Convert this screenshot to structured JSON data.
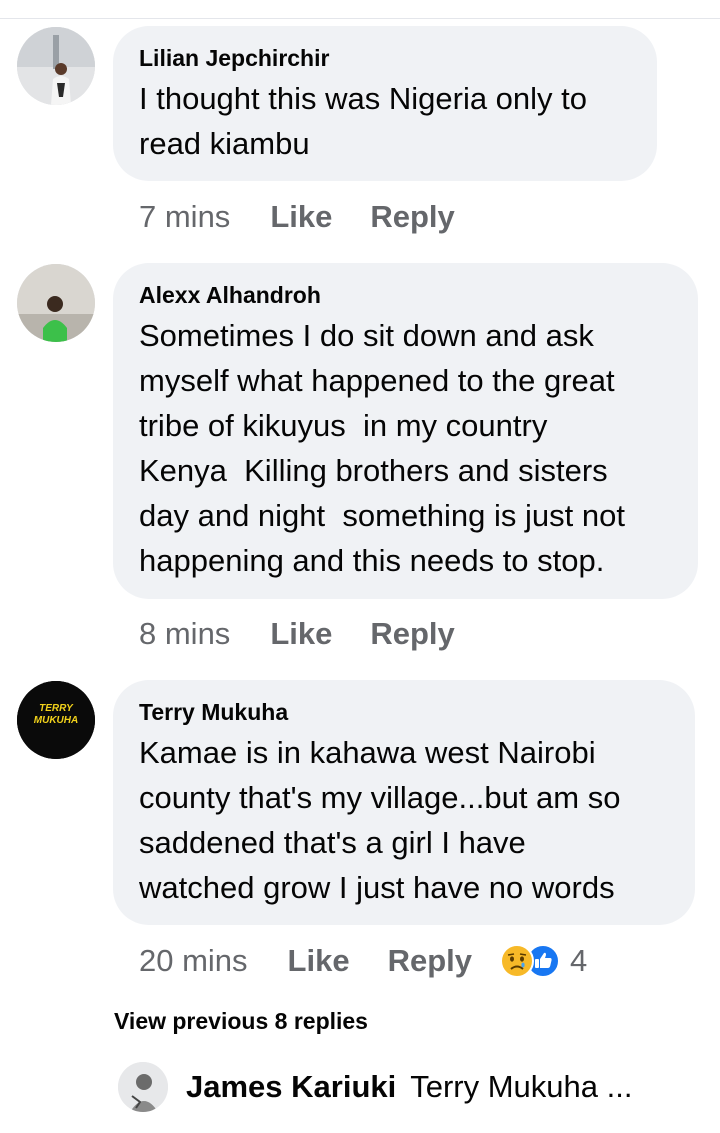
{
  "comments": [
    {
      "author": "Lilian Jepchirchir",
      "text": "I thought this was Nigeria only to\nread kiambu",
      "time": "7 mins",
      "like": "Like",
      "reply": "Reply"
    },
    {
      "author": "Alexx Alhandroh",
      "text": "Sometimes I do sit down and ask\nmyself what happened to the great\ntribe of kikuyus  in my country\nKenya  Killing brothers and sisters\nday and night  something is just not\nhappening and this needs to stop.",
      "time": "8 mins",
      "like": "Like",
      "reply": "Reply"
    },
    {
      "author": "Terry Mukuha",
      "avatar_text": "TERRY MUKUHA",
      "text": "Kamae is in kahawa west Nairobi\ncounty that's my village...but am so\nsaddened that's a girl I have\nwatched grow I just have no words",
      "time": "20 mins",
      "like": "Like",
      "reply": "Reply",
      "reaction_count": "4",
      "reaction_icons": [
        "sad-emoji-icon",
        "thumbs-up-icon"
      ]
    }
  ],
  "view_previous": "View previous 8 replies",
  "latest_reply": {
    "author": "James Kariuki",
    "text": "Terry Mukuha ..."
  },
  "colors": {
    "bubble": "#f0f2f5",
    "meta": "#65676b",
    "like_blue": "#1877f2",
    "sad_yellow": "#f7b928"
  }
}
